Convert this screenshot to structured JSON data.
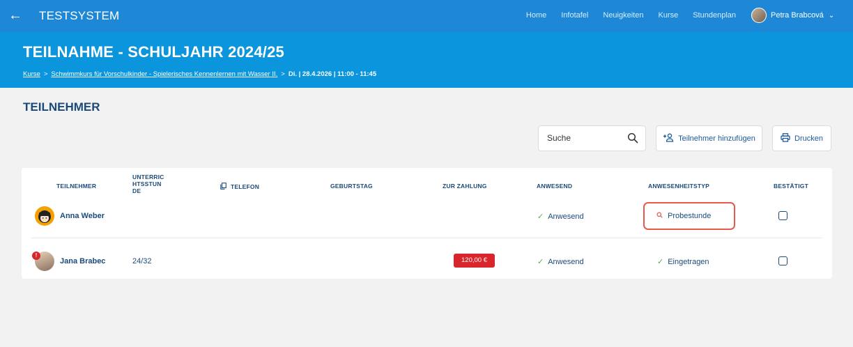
{
  "topbar": {
    "back_icon": "arrow-left-icon",
    "brand": "TESTSYSTEM",
    "nav": [
      "Home",
      "Infotafel",
      "Neuigkeiten",
      "Kurse",
      "Stundenplan"
    ],
    "user_name": "Petra Brabcová"
  },
  "header": {
    "title": "TEILNAHME - SCHULJAHR 2024/25",
    "breadcrumb": {
      "item1": "Kurse",
      "sep": ">",
      "item2": "Schwimmkurs für Vorschulkinder - Spielerisches Kennenlernen mit Wasser II.",
      "current": "Di. | 28.4.2026 | 11:00 - 11:45"
    }
  },
  "section": {
    "title": "TEILNEHMER"
  },
  "toolbar": {
    "search_placeholder": "Suche",
    "add_label": "Teilnehmer hinzufügen",
    "print_label": "Drucken"
  },
  "table": {
    "headers": {
      "teilnehmer": "TEILNEHMER",
      "unterricht_l1": "UNTERRIC",
      "unterricht_l2": "HTSSTUN",
      "unterricht_l3": "DE",
      "telefon": "TELEFON",
      "geburtstag": "GEBURTSTAG",
      "zahlung": "ZUR ZAHLUNG",
      "anwesend": "ANWESEND",
      "typ": "ANWESENHEITSTYP",
      "bestaetigt": "BESTÄTIGT"
    },
    "rows": [
      {
        "name": "Anna Weber",
        "lessons": "",
        "payment": "",
        "present": "Anwesend",
        "type": "Probestunde",
        "type_icon": "search-icon",
        "confirmed": false
      },
      {
        "name": "Jana Brabec",
        "lessons": "24/32",
        "payment": "120,00 €",
        "badge": "!",
        "present": "Anwesend",
        "type": "Eingetragen",
        "type_icon": "check-icon",
        "confirmed": false
      }
    ]
  },
  "colors": {
    "topbar": "#1e88d6",
    "header": "#0a95dd",
    "text_primary": "#1a4a7a",
    "payment_badge": "#d9262c",
    "highlight_border": "#e35a4a",
    "check_green": "#4caf50"
  }
}
